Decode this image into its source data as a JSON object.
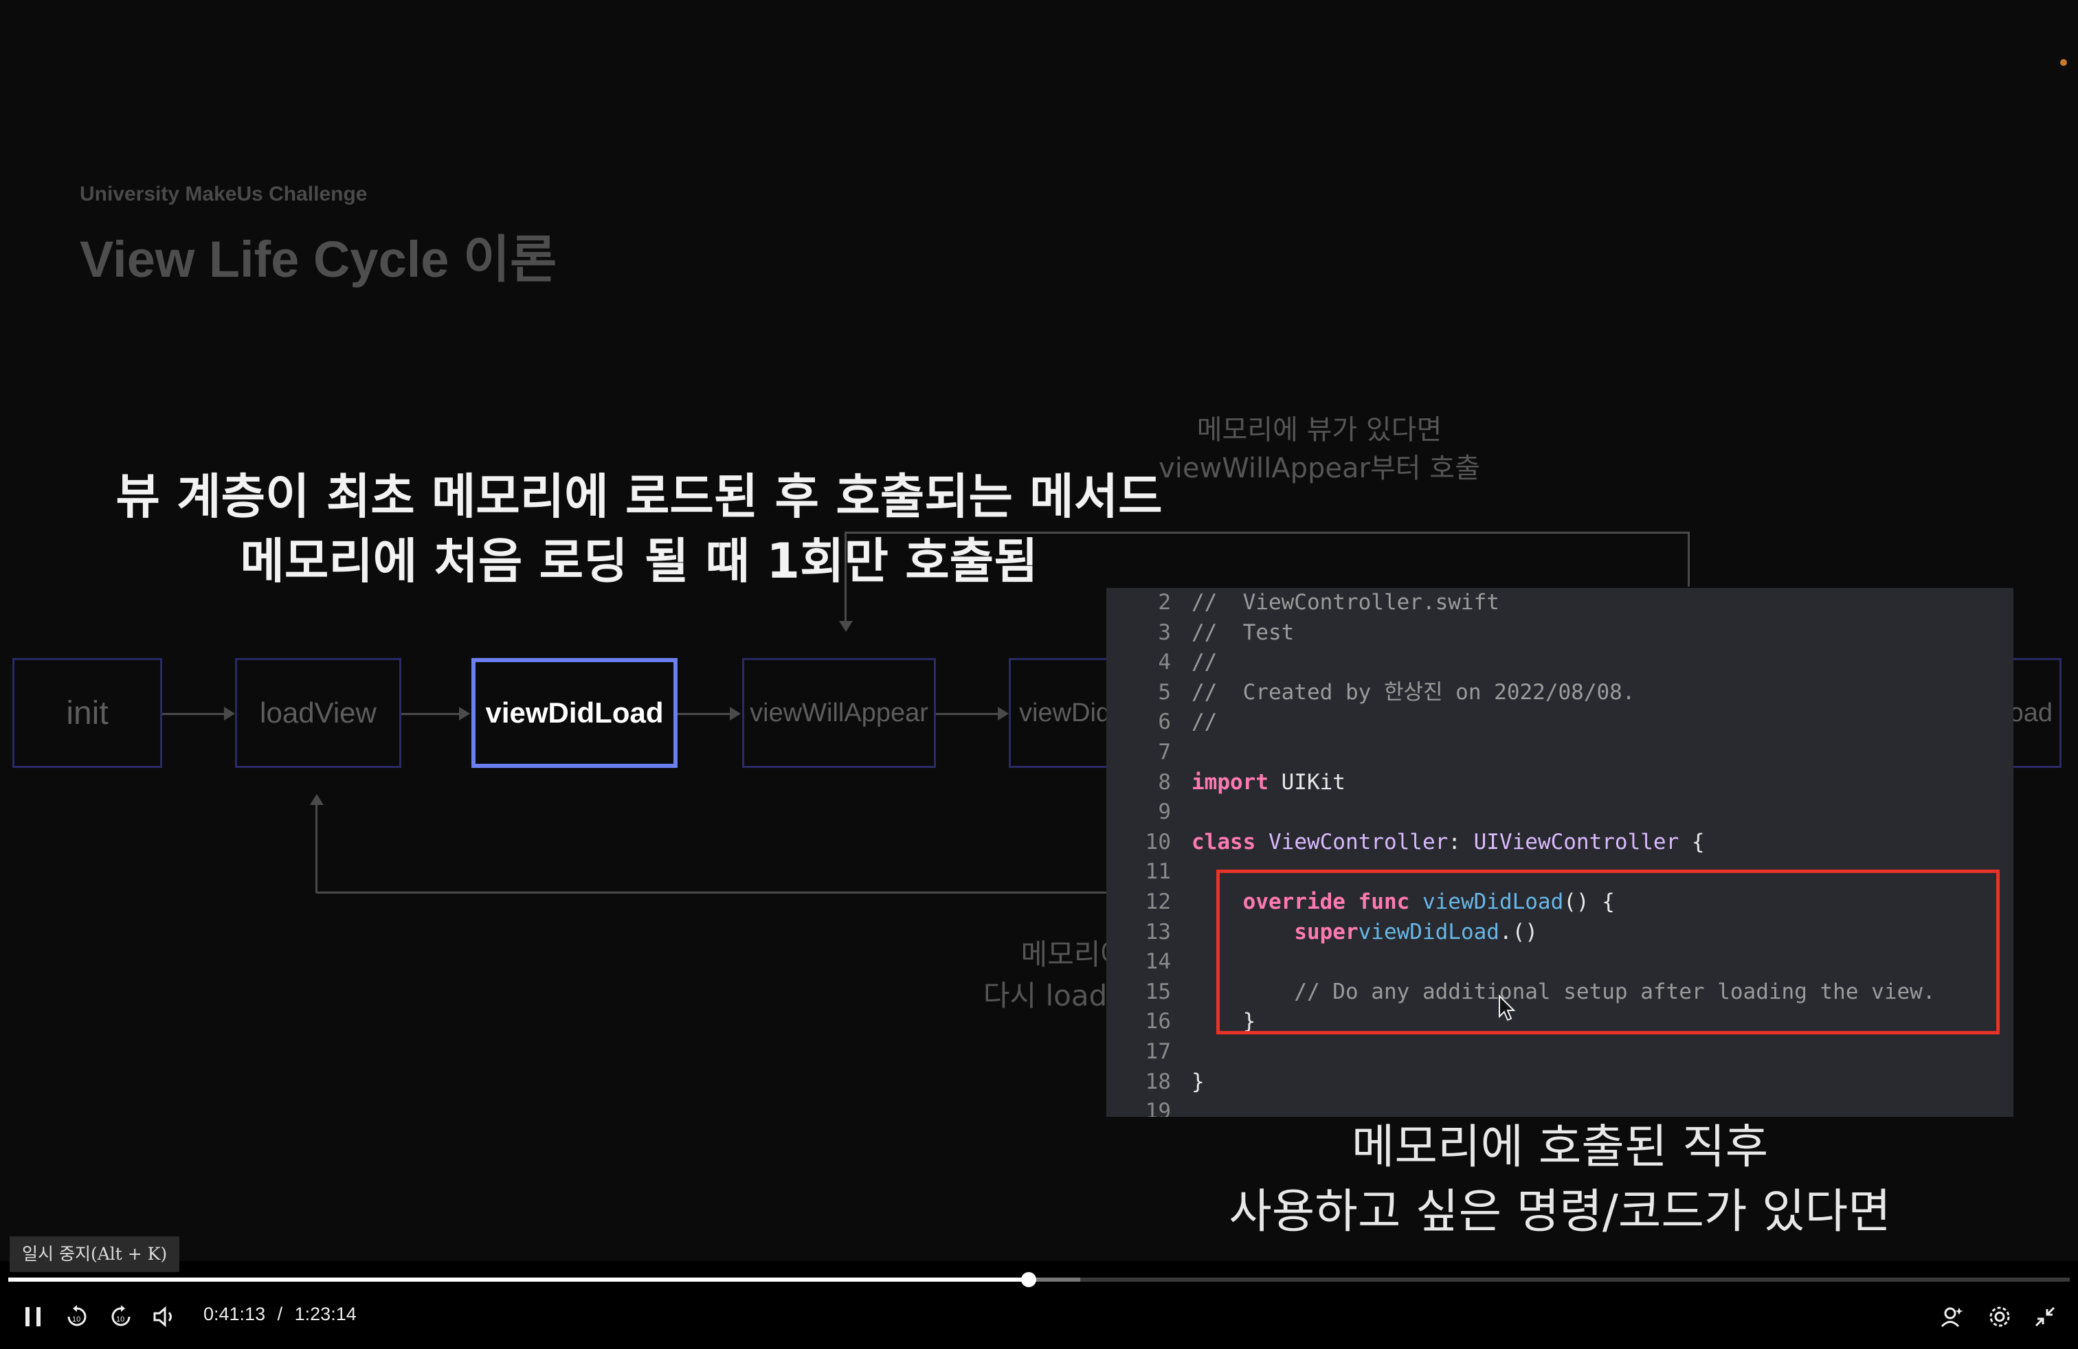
{
  "slide": {
    "subtitle": "University MakeUs Challenge",
    "title": "View Life Cycle 이론",
    "boxes": {
      "init": "init",
      "loadView": "loadView",
      "viewDidLoad": "viewDidLoad",
      "viewWillAppear": "viewWillAppear",
      "viewDid_partial": "viewDid",
      "right_partial": "oad"
    },
    "note_top": [
      "메모리에 뷰가 있다면",
      "viewWillAppear부터 호출"
    ],
    "note_bottom": [
      "메모리에",
      "다시 loadV"
    ]
  },
  "captions": {
    "top_line1": "뷰 계층이 최초 메모리에 로드된 후 호출되는 메서드",
    "top_line2": "메모리에 처음 로딩 될 때 1회만 호출됨",
    "bottom_line1": "메모리에 호출된 직후",
    "bottom_line2": "사용하고 싶은 명령/코드가 있다면"
  },
  "code": {
    "lines": [
      {
        "n": "2",
        "comment": "//  ViewController.swift"
      },
      {
        "n": "3",
        "comment": "//  Test"
      },
      {
        "n": "4",
        "comment": "//"
      },
      {
        "n": "5",
        "comment": "//  Created by 한상진 on 2022/08/08."
      },
      {
        "n": "6",
        "comment": "//"
      },
      {
        "n": "7"
      },
      {
        "n": "8",
        "kw": "import",
        "rest": " UIKit"
      },
      {
        "n": "9"
      },
      {
        "n": "10",
        "kw": "class",
        "type": " ViewController",
        "rest": ": ",
        "type2": "UIViewController",
        "rest2": " {"
      },
      {
        "n": "11"
      },
      {
        "n": "12",
        "indent": "    ",
        "kw": "override func",
        "fn": " viewDidLoad",
        "rest": "() {"
      },
      {
        "n": "13",
        "indent": "        ",
        "kw": "super",
        "rest": ".",
        "fn": "viewDidLoad",
        "rest2": "()"
      },
      {
        "n": "14"
      },
      {
        "n": "15",
        "indent": "        ",
        "comment": "// Do any additional setup after loading the view."
      },
      {
        "n": "16",
        "indent": "    ",
        "rest": "}"
      },
      {
        "n": "17"
      },
      {
        "n": "18",
        "rest": "}"
      },
      {
        "n": "19"
      }
    ]
  },
  "player": {
    "tooltip": "일시 중지(Alt + K)",
    "current_time": "0:41:13",
    "separator": "/",
    "duration": "1:23:14",
    "progress_fraction": 0.495,
    "buffer_fraction": 0.52,
    "icons": {
      "pause": "pause-icon",
      "rewind": "rewind-10-icon",
      "forward": "forward-10-icon",
      "volume": "volume-icon",
      "captions": "ai-assistant-icon",
      "settings": "gear-icon",
      "exit_fullscreen": "exit-fullscreen-icon"
    }
  }
}
